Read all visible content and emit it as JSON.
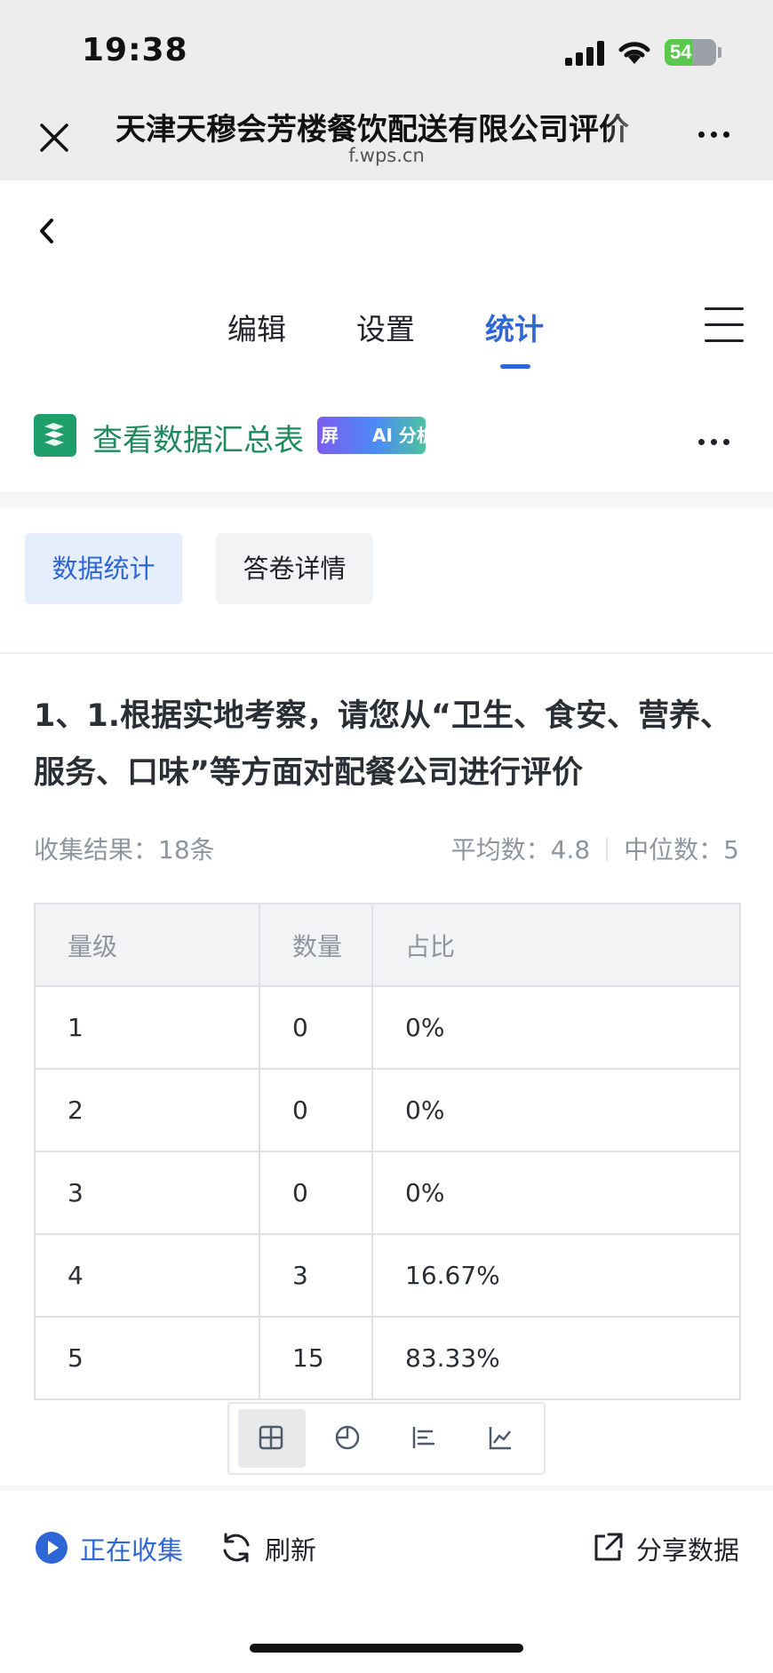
{
  "status_bar": {
    "time": "19:38",
    "battery": "54",
    "battery_level": 0.54
  },
  "browser": {
    "title": "天津天穆会芳楼餐饮配送有限公司评价",
    "url": "f.wps.cn"
  },
  "tabs": [
    {
      "label": "编辑",
      "active": false
    },
    {
      "label": "设置",
      "active": false
    },
    {
      "label": "统计",
      "active": true
    }
  ],
  "summary": {
    "link_label": "查看数据汇总表",
    "badge_left": "屏",
    "badge_right": "AI 分析"
  },
  "subtabs": {
    "primary": "数据统计",
    "secondary": "答卷详情"
  },
  "question": {
    "text": "1、1.根据实地考察，请您从“卫生、食安、营养、服务、口味”等方面对配餐公司进行评价",
    "collected": "收集结果：18条",
    "average": "平均数：4.8",
    "median": "中位数：5"
  },
  "table": {
    "headers": [
      "量级",
      "数量",
      "占比"
    ],
    "rows": [
      [
        "1",
        "0",
        "0%"
      ],
      [
        "2",
        "0",
        "0%"
      ],
      [
        "3",
        "0",
        "0%"
      ],
      [
        "4",
        "3",
        "16.67%"
      ],
      [
        "5",
        "15",
        "83.33%"
      ]
    ]
  },
  "view_toggle": {
    "options": [
      "table-view-icon",
      "pie-chart-icon",
      "bar-chart-icon",
      "line-chart-icon"
    ],
    "active": "table-view-icon"
  },
  "bottom_bar": {
    "collecting": "正在收集",
    "refresh": "刷新",
    "share": "分享数据"
  },
  "colors": {
    "accent": "#2f66d6",
    "summary_green": "#1e8a5e",
    "background": "#ffffff"
  }
}
